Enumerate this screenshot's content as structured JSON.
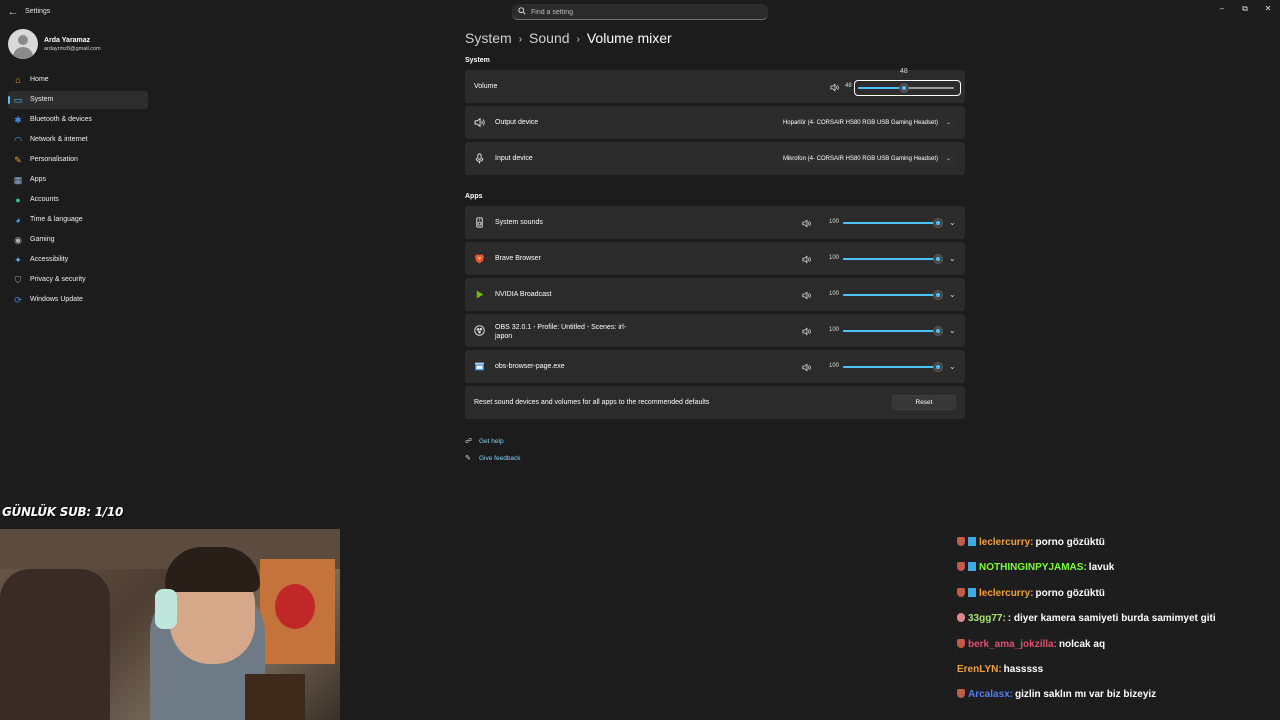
{
  "window": {
    "title": "Settings",
    "search_placeholder": "Find a setting"
  },
  "profile": {
    "name": "Arda Yaramaz",
    "email": "ardayrmz8@gmail.com"
  },
  "nav": [
    {
      "label": "Home",
      "icon": "home-icon",
      "color": "#e8a33c"
    },
    {
      "label": "System",
      "icon": "system-icon",
      "color": "#4cc2ff",
      "active": true
    },
    {
      "label": "Bluetooth & devices",
      "icon": "bluetooth-icon",
      "color": "#3a8ee6"
    },
    {
      "label": "Network & internet",
      "icon": "wifi-icon",
      "color": "#5ab0f0"
    },
    {
      "label": "Personalisation",
      "icon": "brush-icon",
      "color": "#e0a040"
    },
    {
      "label": "Apps",
      "icon": "apps-icon",
      "color": "#8fb0d0"
    },
    {
      "label": "Accounts",
      "icon": "accounts-icon",
      "color": "#2ec27e"
    },
    {
      "label": "Time & language",
      "icon": "globe-clock-icon",
      "color": "#4aa3e8"
    },
    {
      "label": "Gaming",
      "icon": "gaming-icon",
      "color": "#b0b0b0"
    },
    {
      "label": "Accessibility",
      "icon": "accessibility-icon",
      "color": "#5ab0f0"
    },
    {
      "label": "Privacy & security",
      "icon": "shield-icon",
      "color": "#9aa0a6"
    },
    {
      "label": "Windows Update",
      "icon": "update-icon",
      "color": "#3a8ee6"
    }
  ],
  "breadcrumb": {
    "parts": [
      "System",
      "Sound"
    ],
    "current": "Volume mixer"
  },
  "system_section": {
    "title": "System",
    "volume": {
      "label": "Volume",
      "value": "48",
      "tooltip": "48",
      "level": 0.48
    },
    "output": {
      "label": "Output device",
      "value": "Hoparlör (4- CORSAIR HS80 RGB USB Gaming Headset)"
    },
    "input": {
      "label": "Input device",
      "value": "Mikrofon (4- CORSAIR HS80 RGB USB Gaming Headset)"
    }
  },
  "apps_section": {
    "title": "Apps",
    "apps": [
      {
        "name": "System sounds",
        "value": "100",
        "level": 1.0,
        "icon": "system-sounds-icon"
      },
      {
        "name": "Brave Browser",
        "value": "100",
        "level": 1.0,
        "icon": "brave-icon"
      },
      {
        "name": "NVIDIA Broadcast",
        "value": "100",
        "level": 1.0,
        "icon": "nvidia-icon"
      },
      {
        "name": "OBS 32.0.1 - Profile: Untitled - Scenes: irl-",
        "name2": "japon",
        "value": "100",
        "level": 1.0,
        "icon": "obs-icon"
      },
      {
        "name": "obs-browser-page.exe",
        "value": "100",
        "level": 1.0,
        "icon": "app-window-icon"
      }
    ]
  },
  "reset": {
    "text": "Reset sound devices and volumes for all apps to the recommended defaults",
    "button": "Reset"
  },
  "links": {
    "help": "Get help",
    "feedback": "Give feedback"
  },
  "overlay": {
    "daily_sub": "GÜNLÜK SUB: 1/10"
  },
  "chat": [
    {
      "user": "leclercurry:",
      "text": "porno gözüktü",
      "color": "#f0a040",
      "badges": 2
    },
    {
      "user": "NOTHINGINPYJAMAS:",
      "text": "lavuk",
      "color": "#7cfc3a",
      "badges": 2
    },
    {
      "user": "leclercurry:",
      "text": "porno gözüktü",
      "color": "#f0a040",
      "badges": 2
    },
    {
      "user": "33gg77:",
      "text": ": diyer kamera samiyeti burda samimyet giti",
      "color": "#a8e070",
      "badges": 1
    },
    {
      "user": "berk_ama_jokzilla:",
      "text": "nolcak aq",
      "color": "#e05070",
      "badges": 1
    },
    {
      "user": "ErenLYN:",
      "text": "hasssss",
      "color": "#f0a040",
      "badges": 0
    },
    {
      "user": "Arcalasx:",
      "text": "gizlin saklın mı var biz bizeyiz",
      "color": "#5080f0",
      "badges": 1
    }
  ]
}
